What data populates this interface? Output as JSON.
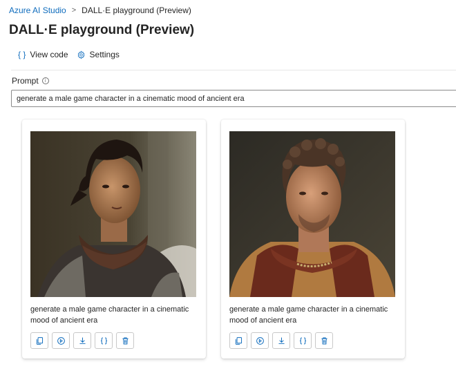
{
  "breadcrumb": {
    "root": "Azure AI Studio",
    "current": "DALL·E playground (Preview)"
  },
  "page": {
    "title": "DALL·E playground (Preview)"
  },
  "toolbar": {
    "view_code_label": "View code",
    "settings_label": "Settings"
  },
  "prompt": {
    "label": "Prompt",
    "value": "generate a male game character in a cinematic mood of ancient era"
  },
  "cards": [
    {
      "image_icon": "generated-image",
      "caption": "generate a male game character in a cinematic mood of ancient era"
    },
    {
      "image_icon": "generated-image",
      "caption": "generate a male game character in a cinematic mood of ancient era"
    }
  ],
  "card_action_icons": [
    "copy-icon",
    "variation-icon",
    "download-icon",
    "code-icon",
    "delete-icon"
  ],
  "colors": {
    "accent": "#0f6cbd",
    "text": "#242424",
    "border": "#c8c8c8"
  }
}
